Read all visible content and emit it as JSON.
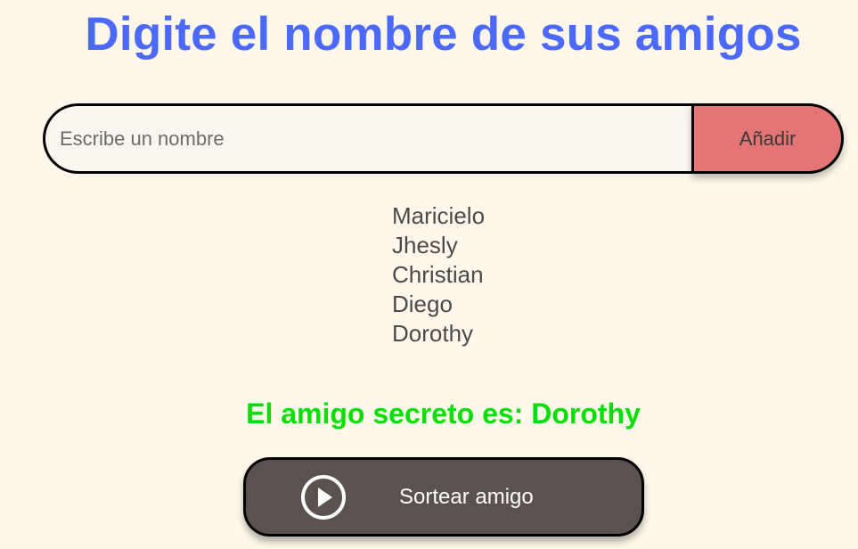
{
  "header": {
    "title": "Digite el nombre de sus amigos"
  },
  "input": {
    "placeholder": "Escribe un nombre",
    "value": ""
  },
  "add_button": {
    "label": "Añadir"
  },
  "friends": [
    "Maricielo",
    "Jhesly",
    "Christian",
    "Diego",
    "Dorothy"
  ],
  "result": {
    "text": "El amigo secreto es: Dorothy"
  },
  "draw_button": {
    "label": "Sortear amigo",
    "icon": "play-circle-icon"
  },
  "colors": {
    "background": "#fff8ea",
    "title": "#4b69fd",
    "add_button": "#e57474",
    "result": "#05df05",
    "draw_button": "#5b5150"
  }
}
